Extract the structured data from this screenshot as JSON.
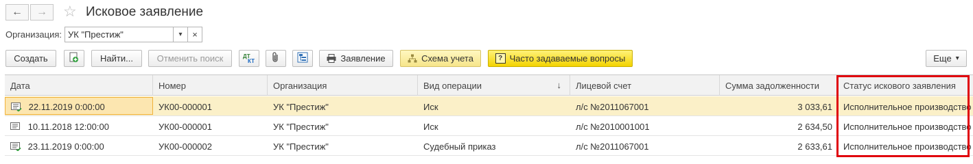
{
  "window": {
    "title": "Исковое заявление",
    "back_icon": "←",
    "forward_icon": "→",
    "star_icon": "☆"
  },
  "filter": {
    "label": "Организация:",
    "value": "УК \"Престиж\"",
    "dropdown_icon": "▾",
    "clear_icon": "×"
  },
  "toolbar": {
    "create": "Создать",
    "find": "Найти...",
    "cancel_search": "Отменить поиск",
    "dt_kt_top": "ДТ",
    "dt_kt_bottom": "КТ",
    "statement": "Заявление",
    "accounting_scheme": "Схема учета",
    "faq_icon": "?",
    "faq": "Часто задаваемые вопросы",
    "more": "Еще",
    "more_icon": "▾",
    "colors": {
      "faq_bg": "#f3d300",
      "scheme_bg": "#f6e58a"
    }
  },
  "table": {
    "columns": [
      "Дата",
      "Номер",
      "Организация",
      "Вид операции",
      "Лицевой счет",
      "Сумма задолженности",
      "Статус искового заявления"
    ],
    "sort_icon": "↓",
    "rows": [
      [
        "22.11.2019 0:00:00",
        "УК00-000001",
        "УК \"Престиж\"",
        "Иск",
        "л/с №2011067001",
        "3 033,61",
        "Исполнительное производство"
      ],
      [
        "10.11.2018 12:00:00",
        "УК00-000001",
        "УК \"Престиж\"",
        "Иск",
        "л/с №2010001001",
        "2 634,50",
        "Исполнительное производство"
      ],
      [
        "23.11.2019 0:00:00",
        "УК00-000002",
        "УК \"Престиж\"",
        "Судебный приказ",
        "л/с №2011067001",
        "2 633,61",
        "Исполнительное производство"
      ]
    ],
    "highlight_color": "#e0000b"
  }
}
